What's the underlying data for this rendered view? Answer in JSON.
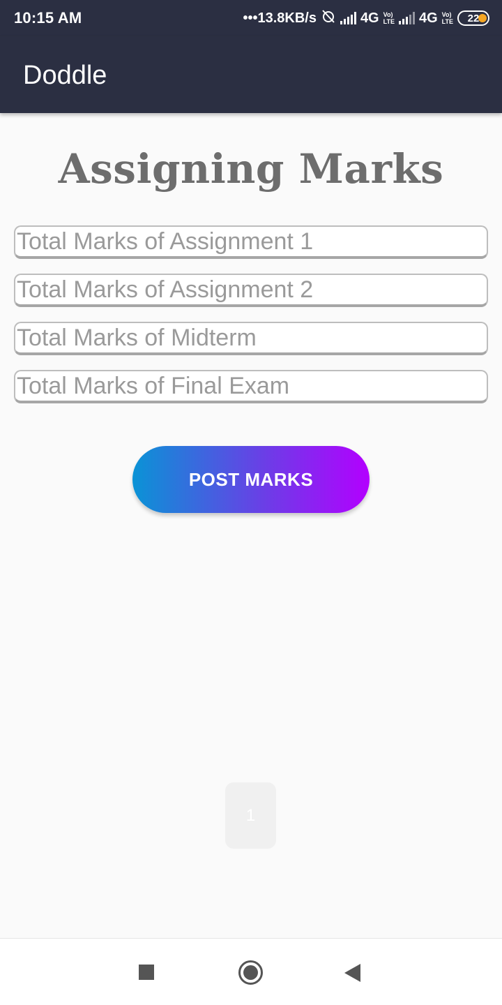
{
  "status_bar": {
    "time": "10:15 AM",
    "network_speed": "•••13.8KB/s",
    "network_type_1": "4G",
    "network_type_2": "4G",
    "volte_top": "Vo)",
    "volte_bottom": "LTE",
    "battery_level": "22"
  },
  "app_bar": {
    "title": "Doddle"
  },
  "page": {
    "heading": "Assigning Marks"
  },
  "form": {
    "fields": [
      {
        "placeholder": "Total Marks of Assignment 1",
        "value": ""
      },
      {
        "placeholder": "Total Marks of Assignment 2",
        "value": ""
      },
      {
        "placeholder": "Total Marks of Midterm",
        "value": ""
      },
      {
        "placeholder": "Total Marks of Final Exam",
        "value": ""
      }
    ],
    "submit_label": "POST MARKS"
  },
  "page_indicator": "1",
  "colors": {
    "app_bar": "#2b2f42",
    "button_gradient_start": "#0a93d6",
    "button_gradient_end": "#b300ff",
    "heading": "#6d6d6d"
  }
}
